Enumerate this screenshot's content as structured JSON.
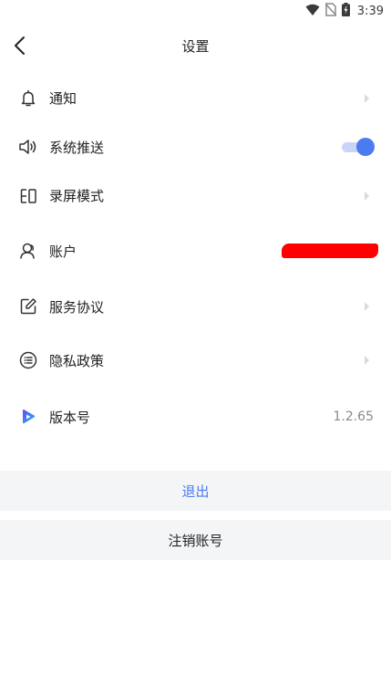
{
  "status_bar": {
    "time": "3:39",
    "icons": [
      "wifi-icon",
      "no-sim-icon",
      "battery-charging-icon"
    ]
  },
  "header": {
    "title": "设置",
    "back_icon": "back-arrow-icon"
  },
  "settings": [
    {
      "label": "通知",
      "icon": "bell-icon",
      "trailing": "chevron"
    },
    {
      "label": "系统推送",
      "icon": "speaker-icon",
      "trailing": "toggle",
      "toggle_on": true
    },
    {
      "label": "录屏模式",
      "icon": "screen-record-icon",
      "trailing": "chevron"
    },
    {
      "label": "账户",
      "icon": "user-icon",
      "trailing": "redacted"
    },
    {
      "label": "服务协议",
      "icon": "edit-document-icon",
      "trailing": "chevron"
    },
    {
      "label": "隐私政策",
      "icon": "list-circle-icon",
      "trailing": "chevron"
    },
    {
      "label": "版本号",
      "icon": "app-logo-icon",
      "trailing": "value",
      "value": "1.2.65"
    }
  ],
  "actions": {
    "logout_label": "退出",
    "delete_account_label": "注销账号"
  },
  "colors": {
    "accent": "#4a7cf0",
    "logout_text": "#4a7cf0",
    "toggle_track": "#c9d5f7",
    "button_bg": "#f4f5f7",
    "chevron": "#cfcfcf",
    "redaction": "#ff0000",
    "icon": "#333333",
    "value_text": "#8a8a8a"
  }
}
